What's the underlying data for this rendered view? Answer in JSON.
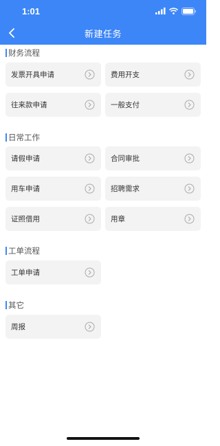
{
  "status_bar": {
    "time": "1:01"
  },
  "nav": {
    "title": "新建任务"
  },
  "sections": [
    {
      "title": "财务流程",
      "items": [
        "发票开具申请",
        "费用开支",
        "往来款申请",
        "一般支付"
      ]
    },
    {
      "title": "日常工作",
      "items": [
        "请假申请",
        "合同审批",
        "用车申请",
        "招聘需求",
        "证照借用",
        "用章"
      ]
    },
    {
      "title": "工单流程",
      "items": [
        "工单申请"
      ]
    },
    {
      "title": "其它",
      "items": [
        "周报"
      ]
    }
  ],
  "colors": {
    "accent": "#3d86f7",
    "card_bg": "#f3f3f3"
  },
  "icons": {
    "back": "chevron-left-icon",
    "item_arrow": "circle-chevron-right-icon"
  }
}
